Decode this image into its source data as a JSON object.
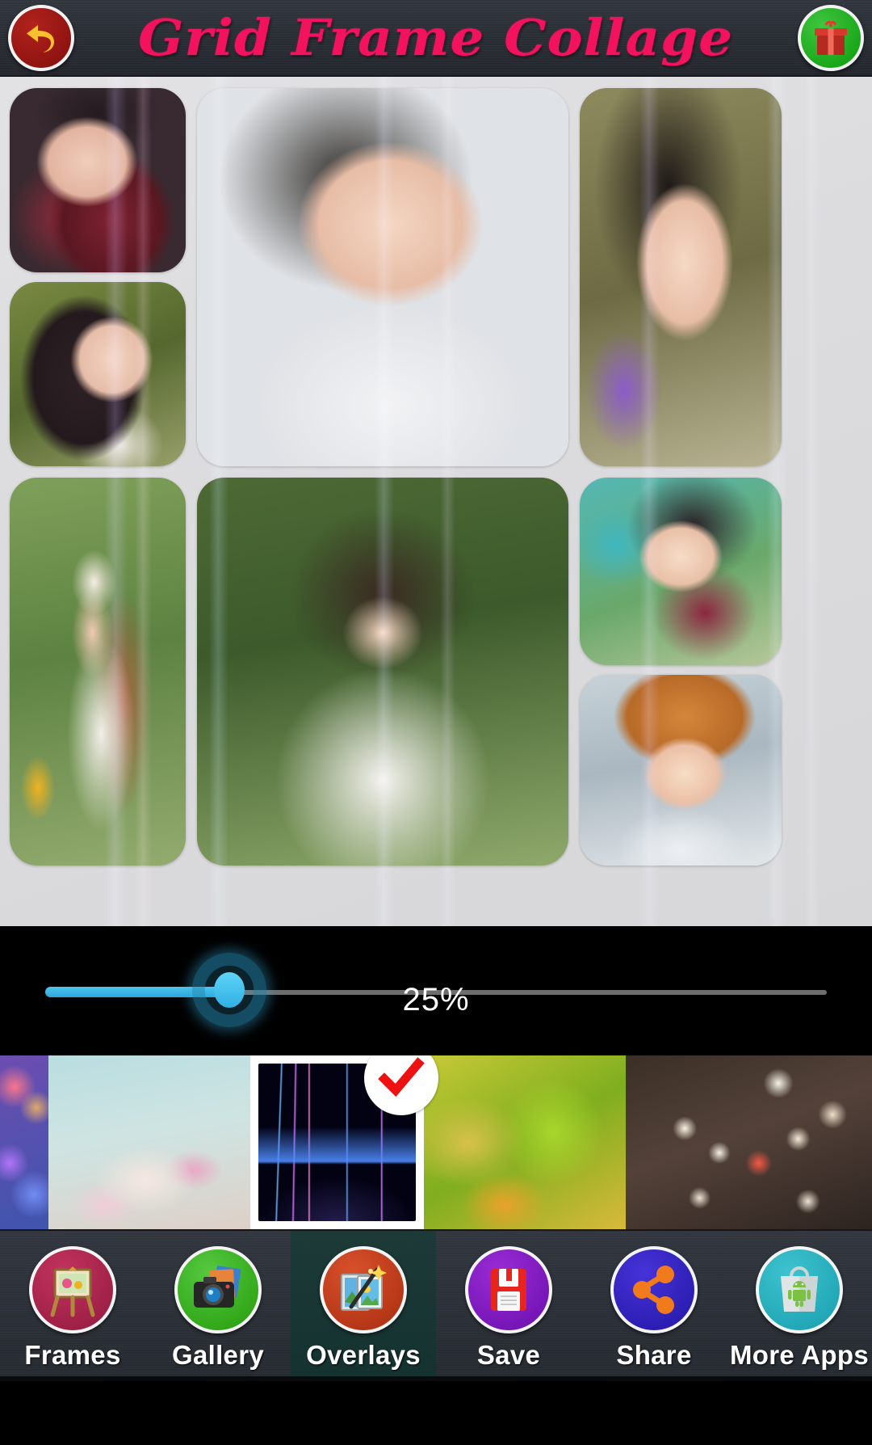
{
  "header": {
    "title": "Grid Frame Collage",
    "back_icon": "back-arrow-icon",
    "gift_icon": "gift-box-icon"
  },
  "canvas": {
    "label": "collage-preview",
    "cells": [
      {
        "id": "cell-1",
        "position": "top-left-upper"
      },
      {
        "id": "cell-2",
        "position": "top-left-lower"
      },
      {
        "id": "cell-3",
        "position": "top-center-large"
      },
      {
        "id": "cell-4",
        "position": "top-right"
      },
      {
        "id": "cell-5",
        "position": "bottom-left"
      },
      {
        "id": "cell-6",
        "position": "bottom-center-large"
      },
      {
        "id": "cell-7",
        "position": "bottom-right-upper"
      },
      {
        "id": "cell-8",
        "position": "bottom-right-lower"
      }
    ]
  },
  "opacity_slider": {
    "value_label": "25%",
    "value": 25,
    "min": 0,
    "max": 100,
    "fill_color": "#33abdf",
    "track_color": "#6d6d6d"
  },
  "overlay_strip": {
    "selected_index": 2,
    "check_icon": "check-icon",
    "check_color": "#ee1111",
    "thumbnails": [
      {
        "id": "overlay-thumb-0",
        "name": "purple-bokeh-overlay",
        "selected": false
      },
      {
        "id": "overlay-thumb-1",
        "name": "magnolia-flower-overlay",
        "selected": false
      },
      {
        "id": "overlay-thumb-2",
        "name": "fireworks-light-trails-overlay",
        "selected": true
      },
      {
        "id": "overlay-thumb-3",
        "name": "green-yellow-swirl-overlay",
        "selected": false
      },
      {
        "id": "overlay-thumb-4",
        "name": "heart-bokeh-lights-overlay",
        "selected": false
      }
    ]
  },
  "toolbar": {
    "active_index": 2,
    "items": [
      {
        "label": "Frames",
        "icon": "easel-painting-icon",
        "color": "#9d1f45"
      },
      {
        "label": "Gallery",
        "icon": "camera-photos-icon",
        "color": "#2fa516"
      },
      {
        "label": "Overlays",
        "icon": "magic-wand-photo-icon",
        "color": "#b23415"
      },
      {
        "label": "Save",
        "icon": "floppy-disk-icon",
        "color": "#7314b4"
      },
      {
        "label": "Share",
        "icon": "share-nodes-icon",
        "color": "#2a1cb0"
      },
      {
        "label": "More Apps",
        "icon": "shopping-bag-android-icon",
        "color": "#1fa5b4"
      }
    ]
  }
}
